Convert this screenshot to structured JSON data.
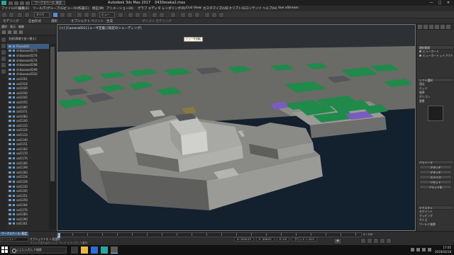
{
  "titlebar": {
    "workspace": "ワークスペース: 既定",
    "app_title": "Autodesk 3ds Max 2017",
    "filename": "0430osaka2.max",
    "minimize": "—",
    "maximize": "□",
    "close": "✕"
  },
  "menubar": {
    "items": [
      "ファイル(F)",
      "編集(E)",
      "ツール(T)",
      "グループ(G)",
      "ビュー(V)",
      "作成(C)",
      "修正(M)",
      "アニメーション(A)",
      "グラフ エディタ",
      "レンダリング(R)",
      "Civil View",
      "カスタマイズ(U)",
      "スクリプト(S)",
      "コンテンツ",
      "ヘルプ(H)",
      "Vue xStream"
    ]
  },
  "toolbar": {
    "selection_filter": "すべて",
    "coord_system": "ビュー"
  },
  "ribbon": {
    "tabs": [
      "モデリング",
      "自由形式",
      "選択",
      "オブジェクト ペイント",
      "生成"
    ],
    "sub_label": "ポリゴン モデリング"
  },
  "scene_explorer": {
    "menu": [
      "選択",
      "表示",
      "編集"
    ],
    "column_header": "名前(昇順で並べ替え)",
    "objects": [
      "Plane001",
      "shikaseos0273",
      "shikaseos0274",
      "shikaseos0274",
      "shikaseos0298",
      "shikaseos0299",
      "shikaseos0310",
      "sal1001",
      "sal1014",
      "sal1020",
      "sal1030",
      "sal1042",
      "sal1055",
      "sal1060",
      "sal1071",
      "sal1083",
      "sal1100",
      "sal1115",
      "sal1124",
      "sal1133",
      "sal1140",
      "sal1151",
      "sal1162",
      "sal1170",
      "sal1176",
      "sal1185",
      "sal1199",
      "sal1200",
      "sal1214",
      "sal1228",
      "sal1230",
      "sal1245",
      "sal1251",
      "sal1259",
      "sal1264",
      "sal1276",
      "sal1283",
      "sal1290",
      "sal1301"
    ],
    "selected_index": 0
  },
  "viewport": {
    "label": "[+] [Camera001] [ユーザ定義] [既定のシェーディング]",
    "tooltip": "ビューを回転",
    "colors": {
      "sky": "#2d3035",
      "ground": "#6a6a66",
      "moat": "#13202e",
      "wall_light": "#9a9a96",
      "wall_dark": "#5e5e5c",
      "roof_green": "#1f8a4a",
      "roof_grey": "#55555a",
      "accent_purple": "#7a5cc0"
    }
  },
  "command_panel": {
    "section1_header": "選択範囲",
    "radio1": "ビューポート",
    "radio2": "ビューポート レイアウト",
    "section2_header": "ソフト選択",
    "list_items": [
      "頂点",
      "エッジ",
      "境界",
      "ポリゴン",
      "要素"
    ],
    "section3_header": "パラメータ",
    "buttons": [
      "アタッチ",
      "デタッチ",
      "スライス",
      "リセット",
      "フラット化"
    ],
    "section4_header": "テクスチャ",
    "params": [
      "セグメント",
      "マッピング",
      "サイズ",
      "ワールド座標"
    ]
  },
  "timeline": {
    "workspace_tab": "ワークスペース: 既定",
    "maxscript": "ミニリスナー",
    "status": "オブジェクトを 1 個選択",
    "status2": "クリックまたはクリック アンド ドラッグして選択",
    "frame_counter": "0 / 100",
    "coord_x": "X: 1204.23",
    "coord_y": "Y: -356.02",
    "coord_z": "Z: 0.0",
    "grid": "グリッド = 10.0"
  },
  "taskbar": {
    "search_placeholder": "ここに入力して検索",
    "time": "17:05",
    "date": "2019/03/18"
  }
}
